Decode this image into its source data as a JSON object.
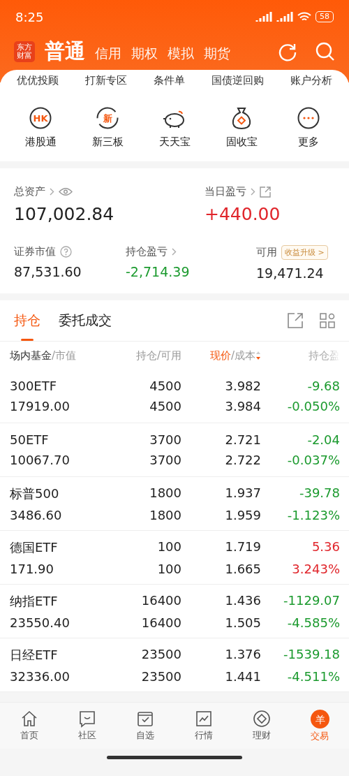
{
  "status_bar": {
    "time": "8:25",
    "battery": "58"
  },
  "header": {
    "logo": [
      "东方",
      "财富"
    ],
    "tabs": [
      {
        "label": "普通",
        "selected": true
      },
      {
        "label": "信用",
        "selected": false
      },
      {
        "label": "期权",
        "selected": false
      },
      {
        "label": "模拟",
        "selected": false
      },
      {
        "label": "期货",
        "selected": false
      }
    ]
  },
  "quick_links": [
    "优优投顾",
    "打新专区",
    "条件单",
    "国债逆回购",
    "账户分析"
  ],
  "services": [
    {
      "label": "港股通",
      "kind": "hk",
      "badge": "HK"
    },
    {
      "label": "新三板",
      "kind": "new",
      "badge": "新"
    },
    {
      "label": "天天宝",
      "kind": "piggy"
    },
    {
      "label": "固收宝",
      "kind": "bag"
    },
    {
      "label": "更多",
      "kind": "more"
    }
  ],
  "assets": {
    "total_label": "总资产",
    "total_value": "107,002.84",
    "daily_label": "当日盈亏",
    "daily_value": "+440.00",
    "market_label": "证券市值",
    "market_value": "87,531.60",
    "holding_label": "持仓盈亏",
    "holding_value": "-2,714.39",
    "available_label": "可用",
    "upgrade_badge": "收益升级 >",
    "available_value": "19,471.24"
  },
  "tabs": [
    {
      "label": "持仓",
      "selected": true
    },
    {
      "label": "委托成交",
      "selected": false
    }
  ],
  "table": {
    "columns": [
      {
        "label": "场内基金",
        "sublabel": "/市值",
        "sorted": false
      },
      {
        "label": "持仓/可用",
        "sorted": false
      },
      {
        "label": "现价",
        "sublabel": "/成本",
        "sorted": true
      },
      {
        "label": "持仓盈",
        "sorted": false
      }
    ],
    "rows": [
      {
        "name": "300ETF",
        "market_value": "17919.00",
        "holding": "4500",
        "available": "4500",
        "price": "3.982",
        "cost": "3.984",
        "pnl": "-9.68",
        "pnl_pct": "-0.050%",
        "color": "#1b9a2e"
      },
      {
        "name": "50ETF",
        "market_value": "10067.70",
        "holding": "3700",
        "available": "3700",
        "price": "2.721",
        "cost": "2.722",
        "pnl": "-2.04",
        "pnl_pct": "-0.037%",
        "color": "#1b9a2e"
      },
      {
        "name": "标普500",
        "market_value": "3486.60",
        "holding": "1800",
        "available": "1800",
        "price": "1.937",
        "cost": "1.959",
        "pnl": "-39.78",
        "pnl_pct": "-1.123%",
        "color": "#1b9a2e"
      },
      {
        "name": "德国ETF",
        "market_value": "171.90",
        "holding": "100",
        "available": "100",
        "price": "1.719",
        "cost": "1.665",
        "pnl": "5.36",
        "pnl_pct": "3.243%",
        "color": "#e0252b"
      },
      {
        "name": "纳指ETF",
        "market_value": "23550.40",
        "holding": "16400",
        "available": "16400",
        "price": "1.436",
        "cost": "1.505",
        "pnl": "-1129.07",
        "pnl_pct": "-4.585%",
        "color": "#1b9a2e"
      },
      {
        "name": "日经ETF",
        "market_value": "32336.00",
        "holding": "23500",
        "available": "23500",
        "price": "1.376",
        "cost": "1.441",
        "pnl": "-1539.18",
        "pnl_pct": "-4.511%",
        "color": "#1b9a2e"
      }
    ]
  },
  "bottom_nav": [
    {
      "label": "首页",
      "kind": "home",
      "selected": false
    },
    {
      "label": "社区",
      "kind": "chat",
      "selected": false
    },
    {
      "label": "自选",
      "kind": "check",
      "selected": false
    },
    {
      "label": "行情",
      "kind": "chart",
      "selected": false
    },
    {
      "label": "理财",
      "kind": "diamond",
      "selected": false
    },
    {
      "label": "交易",
      "kind": "trade",
      "badge": "羊",
      "selected": true
    }
  ]
}
